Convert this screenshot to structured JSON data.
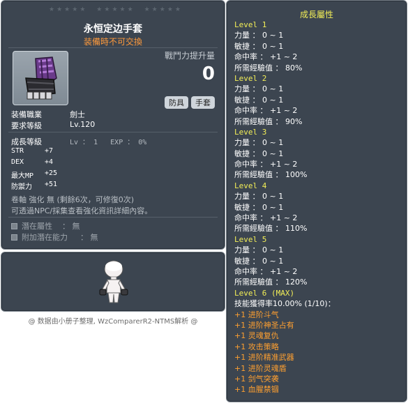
{
  "item_id": "01082234",
  "item": {
    "name": "永恒定边手套",
    "trade_status": "装備時不可交換",
    "power_label": "戰鬥力提升量",
    "power_value": "0",
    "categories": [
      "防具",
      "手套"
    ],
    "job_label": "装備職業",
    "job_value": "劍士",
    "req_level_label": "要求等級",
    "req_level_value": "Lv.120",
    "growth_label": "成長等級",
    "growth_value": "Lv ： 1   EXP ： 0%",
    "stats": [
      {
        "name": "STR",
        "value": "+7"
      },
      {
        "name": "DEX",
        "value": "+4"
      },
      {
        "name": "最大MP",
        "value": "+25"
      },
      {
        "name": "防禦力",
        "value": "+51"
      }
    ],
    "upgrade_note": "卷軸 強化 無 (剩餘6次，可修復0次)",
    "npc_note": "可透過NPC/採集查看強化資訊詳細內容。",
    "potentials": [
      {
        "label": "潛在屬性",
        "value": "： 無"
      },
      {
        "label": "附加潛在能力",
        "value": "： 無"
      }
    ]
  },
  "credit": "@ 数据由小册子整理, WzComparerR2-NTMS解析 @",
  "growth": {
    "title": "成長屬性",
    "lines": [
      {
        "type": "level",
        "text": "Level 1"
      },
      {
        "type": "stat",
        "text": "力量 ： 0 ~ 1"
      },
      {
        "type": "stat",
        "text": "敏捷 ： 0 ~ 1"
      },
      {
        "type": "stat",
        "text": "命中率 ： +1 ~ 2"
      },
      {
        "type": "stat",
        "text": "所需經驗值 ： 80%"
      },
      {
        "type": "level",
        "text": "Level 2"
      },
      {
        "type": "stat",
        "text": "力量 ： 0 ~ 1"
      },
      {
        "type": "stat",
        "text": "敏捷 ： 0 ~ 1"
      },
      {
        "type": "stat",
        "text": "命中率 ： +1 ~ 2"
      },
      {
        "type": "stat",
        "text": "所需經驗值 ： 90%"
      },
      {
        "type": "level",
        "text": "Level 3"
      },
      {
        "type": "stat",
        "text": "力量 ： 0 ~ 1"
      },
      {
        "type": "stat",
        "text": "敏捷 ： 0 ~ 1"
      },
      {
        "type": "stat",
        "text": "命中率 ： +1 ~ 2"
      },
      {
        "type": "stat",
        "text": "所需經驗值 ： 100%"
      },
      {
        "type": "level",
        "text": "Level 4"
      },
      {
        "type": "stat",
        "text": "力量 ： 0 ~ 1"
      },
      {
        "type": "stat",
        "text": "敏捷 ： 0 ~ 1"
      },
      {
        "type": "stat",
        "text": "命中率 ： +1 ~ 2"
      },
      {
        "type": "stat",
        "text": "所需經驗值 ： 110%"
      },
      {
        "type": "level",
        "text": "Level 5"
      },
      {
        "type": "stat",
        "text": "力量 ： 0 ~ 1"
      },
      {
        "type": "stat",
        "text": "敏捷 ： 0 ~ 1"
      },
      {
        "type": "stat",
        "text": "命中率 ： +1 ~ 2"
      },
      {
        "type": "stat",
        "text": "所需經驗值 ： 120%"
      },
      {
        "type": "level",
        "text": "Level 6 (MAX)"
      },
      {
        "type": "stat",
        "text": "技能獲得率10.00% (1/10)："
      },
      {
        "type": "skill",
        "text": "+1 进阶斗气"
      },
      {
        "type": "skill",
        "text": "+1 进阶神圣占有"
      },
      {
        "type": "skill",
        "text": "+1 灵魂复仇"
      },
      {
        "type": "skill",
        "text": "+1 攻击策略"
      },
      {
        "type": "skill",
        "text": "+1 进阶精准武器"
      },
      {
        "type": "skill",
        "text": "+1 进阶灵魂盾"
      },
      {
        "type": "skill",
        "text": "+1 剑气突袭"
      },
      {
        "type": "skill",
        "text": "+1 血腥禁锢"
      }
    ]
  },
  "colors": {
    "panel_bg": "#3c4550",
    "trade_orange": "#ff9a3c",
    "level_yellow": "#f2ee57",
    "skill_orange": "#ffa030"
  },
  "icons": [
    "gauntlet-item-icon",
    "star-icon",
    "character-avatar"
  ]
}
